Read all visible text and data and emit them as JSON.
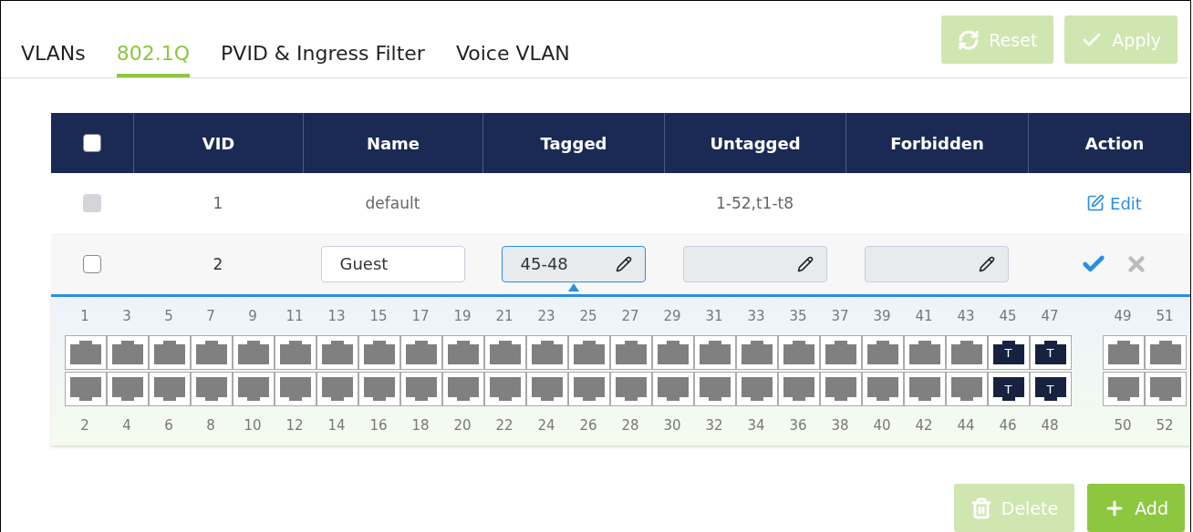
{
  "tabs": [
    {
      "label": "VLANs",
      "selected": false
    },
    {
      "label": "802.1Q",
      "selected": true
    },
    {
      "label": "PVID & Ingress Filter",
      "selected": false
    },
    {
      "label": "Voice VLAN",
      "selected": false
    }
  ],
  "top_buttons": [
    {
      "label": "Reset",
      "kind": "refresh",
      "disabled": true
    },
    {
      "label": "Apply",
      "kind": "check",
      "disabled": true
    }
  ],
  "table": {
    "select_all": {
      "checked": false
    },
    "columns": [
      "VID",
      "Name",
      "Tagged",
      "Untagged",
      "Forbidden",
      "Action"
    ],
    "rows": [
      {
        "kind": "view",
        "checked": false,
        "disabled": true,
        "vid": "1",
        "name": "default",
        "untagged": "1-52,t1-t8",
        "action": "Edit"
      },
      {
        "kind": "edit",
        "checked": false,
        "disabled": false,
        "vid": "2",
        "fields": [
          {
            "kind": "text",
            "value": "Guest",
            "active": false
          },
          {
            "kind": "picker",
            "value": "45-48",
            "active": true
          },
          {
            "kind": "picker",
            "active": false
          },
          {
            "kind": "picker",
            "active": false
          }
        ]
      }
    ],
    "port_groups": [
      {
        "columns": [
          {
            "top": {
              "label": "1",
              "tagged": false
            },
            "bottom": {
              "label": "2",
              "tagged": false
            }
          },
          {
            "top": {
              "label": "3",
              "tagged": false
            },
            "bottom": {
              "label": "4",
              "tagged": false
            }
          },
          {
            "top": {
              "label": "5",
              "tagged": false
            },
            "bottom": {
              "label": "6",
              "tagged": false
            }
          },
          {
            "top": {
              "label": "7",
              "tagged": false
            },
            "bottom": {
              "label": "8",
              "tagged": false
            }
          },
          {
            "top": {
              "label": "9",
              "tagged": false
            },
            "bottom": {
              "label": "10",
              "tagged": false
            }
          },
          {
            "top": {
              "label": "11",
              "tagged": false
            },
            "bottom": {
              "label": "12",
              "tagged": false
            }
          },
          {
            "top": {
              "label": "13",
              "tagged": false
            },
            "bottom": {
              "label": "14",
              "tagged": false
            }
          },
          {
            "top": {
              "label": "15",
              "tagged": false
            },
            "bottom": {
              "label": "16",
              "tagged": false
            }
          },
          {
            "top": {
              "label": "17",
              "tagged": false
            },
            "bottom": {
              "label": "18",
              "tagged": false
            }
          },
          {
            "top": {
              "label": "19",
              "tagged": false
            },
            "bottom": {
              "label": "20",
              "tagged": false
            }
          },
          {
            "top": {
              "label": "21",
              "tagged": false
            },
            "bottom": {
              "label": "22",
              "tagged": false
            }
          },
          {
            "top": {
              "label": "23",
              "tagged": false
            },
            "bottom": {
              "label": "24",
              "tagged": false
            }
          },
          {
            "top": {
              "label": "25",
              "tagged": false
            },
            "bottom": {
              "label": "26",
              "tagged": false
            }
          },
          {
            "top": {
              "label": "27",
              "tagged": false
            },
            "bottom": {
              "label": "28",
              "tagged": false
            }
          },
          {
            "top": {
              "label": "29",
              "tagged": false
            },
            "bottom": {
              "label": "30",
              "tagged": false
            }
          },
          {
            "top": {
              "label": "31",
              "tagged": false
            },
            "bottom": {
              "label": "32",
              "tagged": false
            }
          },
          {
            "top": {
              "label": "33",
              "tagged": false
            },
            "bottom": {
              "label": "34",
              "tagged": false
            }
          },
          {
            "top": {
              "label": "35",
              "tagged": false
            },
            "bottom": {
              "label": "36",
              "tagged": false
            }
          },
          {
            "top": {
              "label": "37",
              "tagged": false
            },
            "bottom": {
              "label": "38",
              "tagged": false
            }
          },
          {
            "top": {
              "label": "39",
              "tagged": false
            },
            "bottom": {
              "label": "40",
              "tagged": false
            }
          },
          {
            "top": {
              "label": "41",
              "tagged": false
            },
            "bottom": {
              "label": "42",
              "tagged": false
            }
          },
          {
            "top": {
              "label": "43",
              "tagged": false
            },
            "bottom": {
              "label": "44",
              "tagged": false
            }
          },
          {
            "top": {
              "label": "45",
              "tagged": true,
              "badge": "T"
            },
            "bottom": {
              "label": "46",
              "tagged": true,
              "badge": "T"
            }
          },
          {
            "top": {
              "label": "47",
              "tagged": true,
              "badge": "T"
            },
            "bottom": {
              "label": "48",
              "tagged": true,
              "badge": "T"
            }
          }
        ]
      },
      {
        "columns": [
          {
            "top": {
              "label": "49",
              "tagged": false
            },
            "bottom": {
              "label": "50",
              "tagged": false
            }
          },
          {
            "top": {
              "label": "51",
              "tagged": false
            },
            "bottom": {
              "label": "52",
              "tagged": false
            }
          }
        ]
      }
    ]
  },
  "bottom_buttons": [
    {
      "label": "Delete",
      "kind": "trash",
      "disabled": true
    },
    {
      "label": "Add",
      "kind": "plus",
      "disabled": false
    }
  ]
}
